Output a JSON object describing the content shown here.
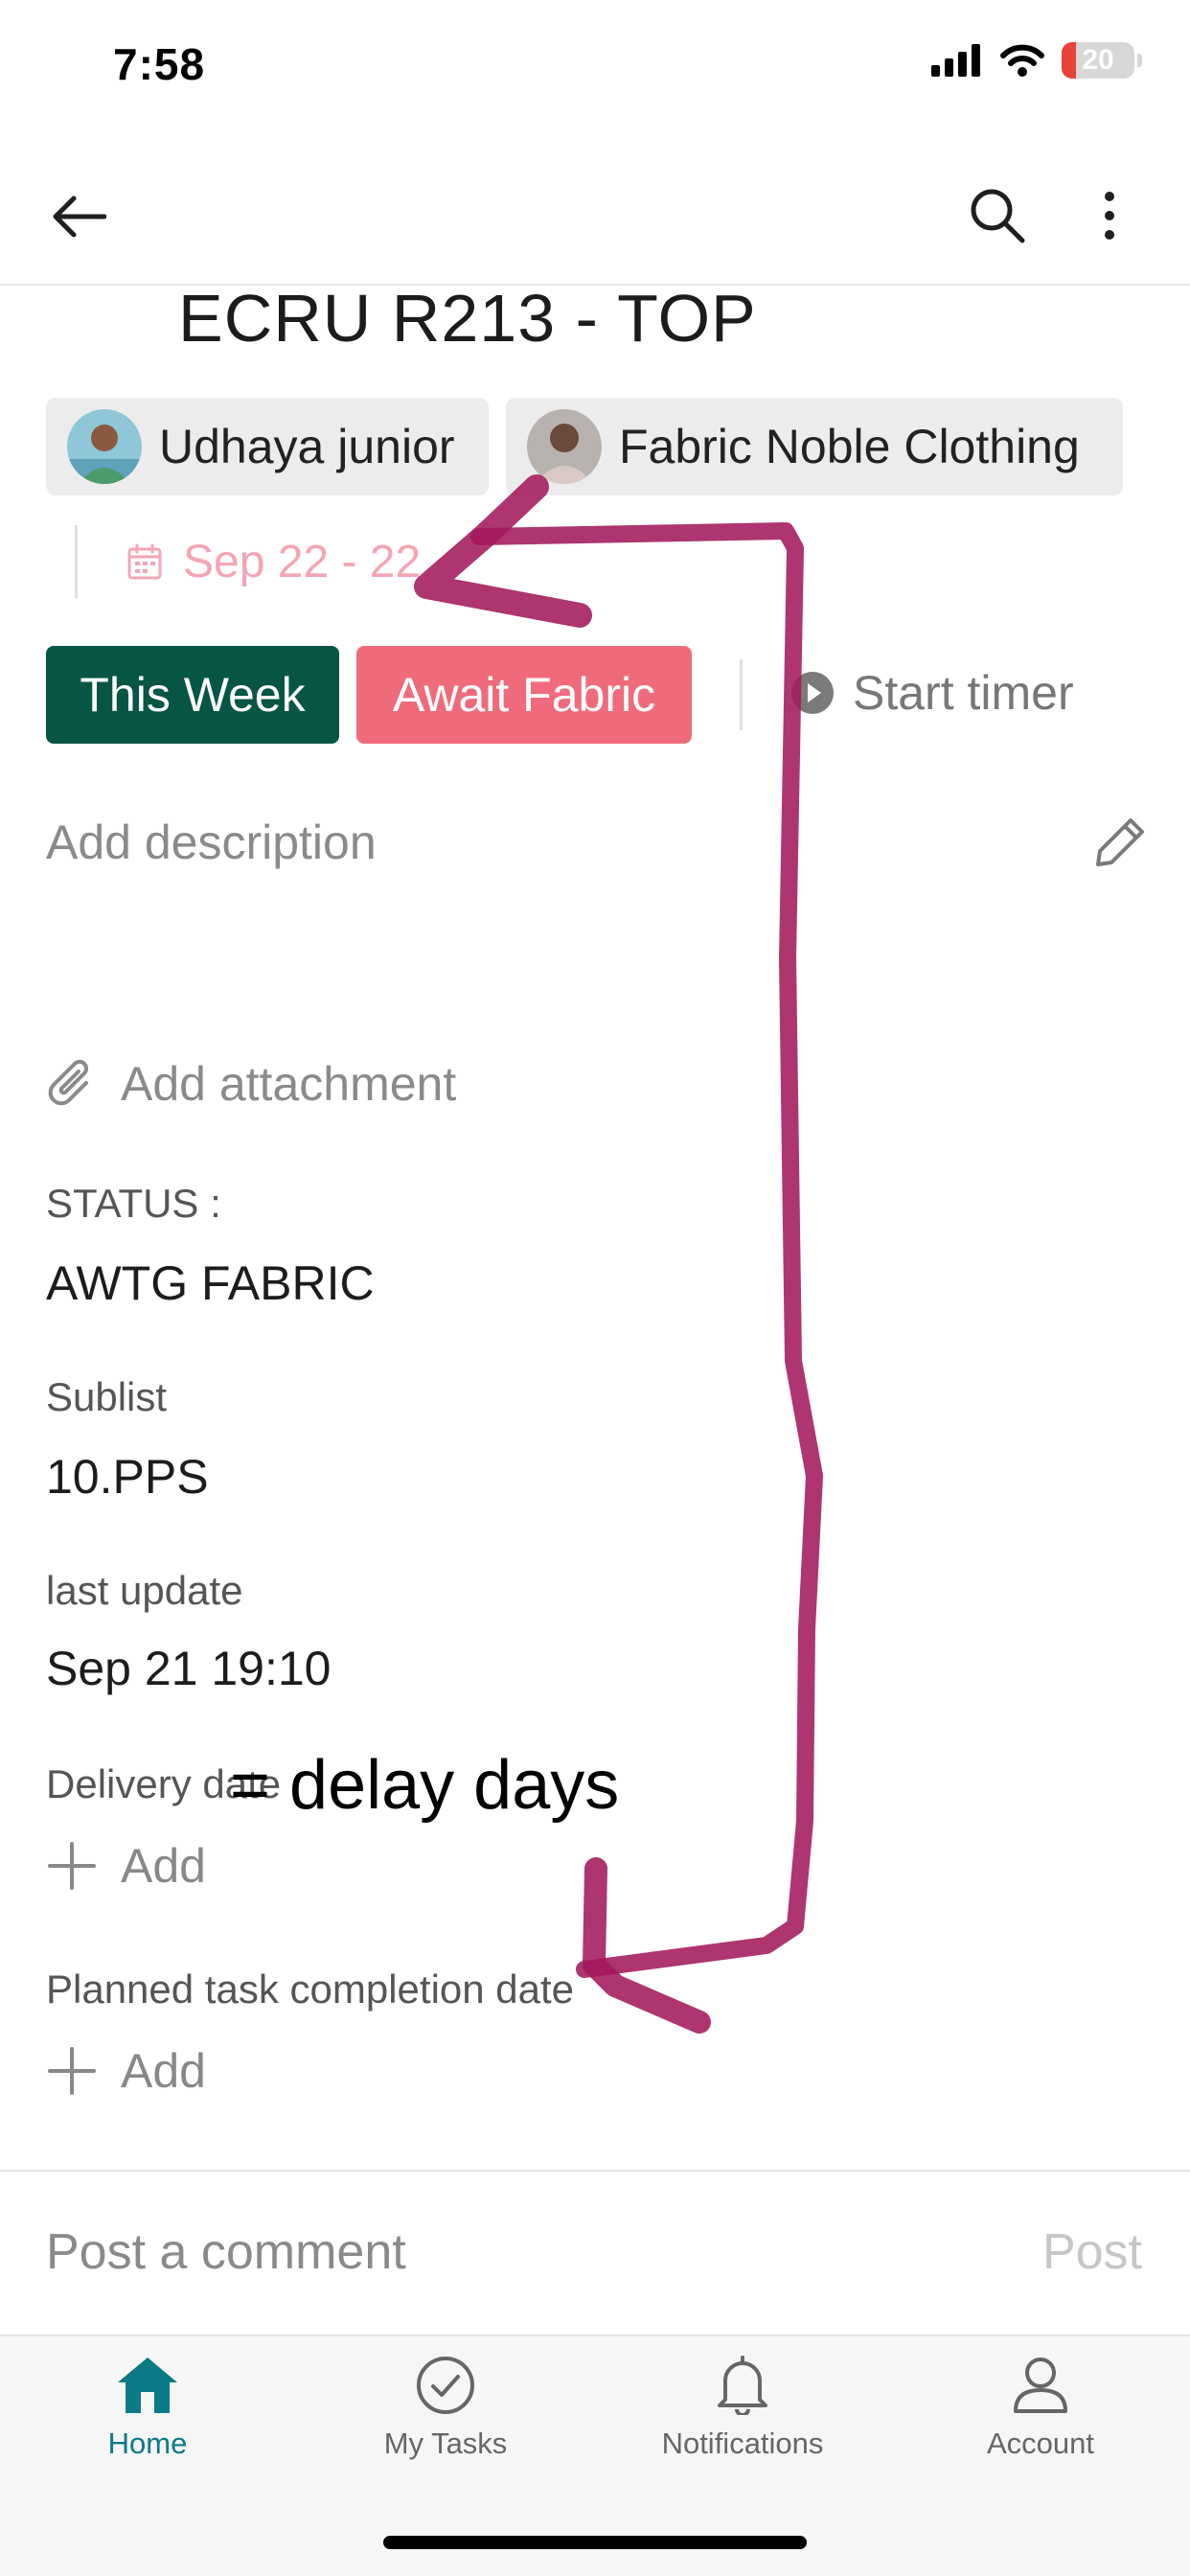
{
  "status_bar": {
    "time": "7:58",
    "battery": "20",
    "battery_level": 0.2
  },
  "task": {
    "title": "ECRU R213 - TOP",
    "assignees": [
      {
        "name": "Udhaya junior"
      },
      {
        "name": "Fabric Noble Clothing"
      }
    ],
    "date_range": "Sep 22 - 22",
    "tags": [
      {
        "label": "This Week",
        "color": "#075545"
      },
      {
        "label": "Await Fabric",
        "color": "#ef6b7c"
      }
    ],
    "timer_label": "Start timer",
    "description_placeholder": "Add description",
    "attachment_label": "Add attachment"
  },
  "fields": {
    "status": {
      "label": "STATUS :",
      "value": "AWTG FABRIC"
    },
    "sublist": {
      "label": "Sublist",
      "value": "10.PPS"
    },
    "last_update": {
      "label": "last update",
      "value": "Sep 21 19:10"
    },
    "delivery_date": {
      "label": "Delivery date",
      "add_label": "Add"
    },
    "planned_completion": {
      "label": "Planned task completion date",
      "add_label": "Add"
    }
  },
  "annotation": {
    "text": "= delay days",
    "color": "#a3195b"
  },
  "comment": {
    "placeholder": "Post a comment",
    "post_label": "Post"
  },
  "tabbar": {
    "active_color": "#0a7a86",
    "items": [
      {
        "label": "Home",
        "icon": "home-icon"
      },
      {
        "label": "My Tasks",
        "icon": "check-circle-icon"
      },
      {
        "label": "Notifications",
        "icon": "bell-icon"
      },
      {
        "label": "Account",
        "icon": "person-icon"
      }
    ]
  }
}
